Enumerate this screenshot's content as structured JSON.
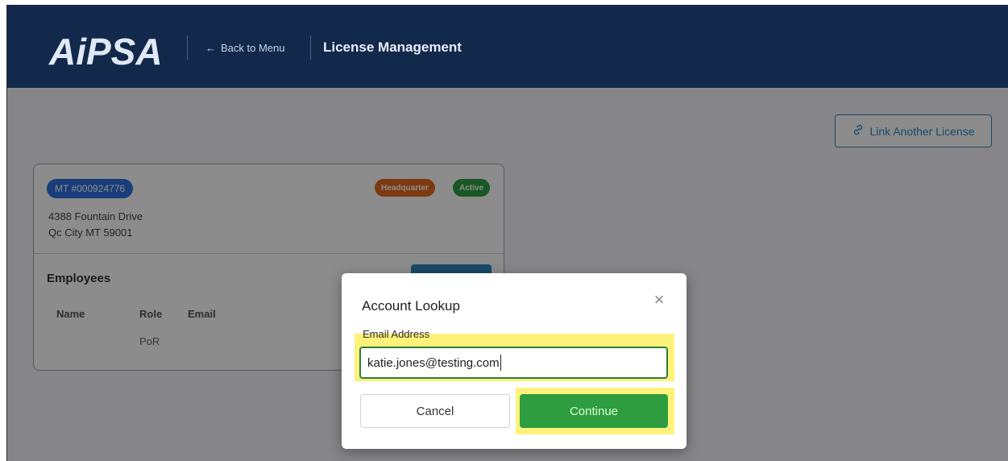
{
  "header": {
    "logo_text": "AiPSA",
    "back_label": "Back to Menu",
    "title": "License Management"
  },
  "toolbar": {
    "link_license_label": "Link Another License"
  },
  "license": {
    "number": "MT #000924776",
    "badges": [
      "Headquarter",
      "Active"
    ],
    "address_line1": "4388 Fountain Drive",
    "address_line2": "Qc City MT 59001"
  },
  "employees": {
    "title": "Employees",
    "columns": [
      "Name",
      "Role",
      "Email"
    ],
    "rows": [
      {
        "name": "",
        "role": "PoR",
        "email": ""
      }
    ]
  },
  "modal": {
    "title": "Account Lookup",
    "field_label": "Email Address",
    "email_value": "katie.jones@testing.com",
    "cancel_label": "Cancel",
    "continue_label": "Continue"
  },
  "colors": {
    "header_bg": "#13294b",
    "accent_blue": "#2f86c0",
    "success_green": "#2e9d3f",
    "highlight_yellow": "#fff27a"
  }
}
